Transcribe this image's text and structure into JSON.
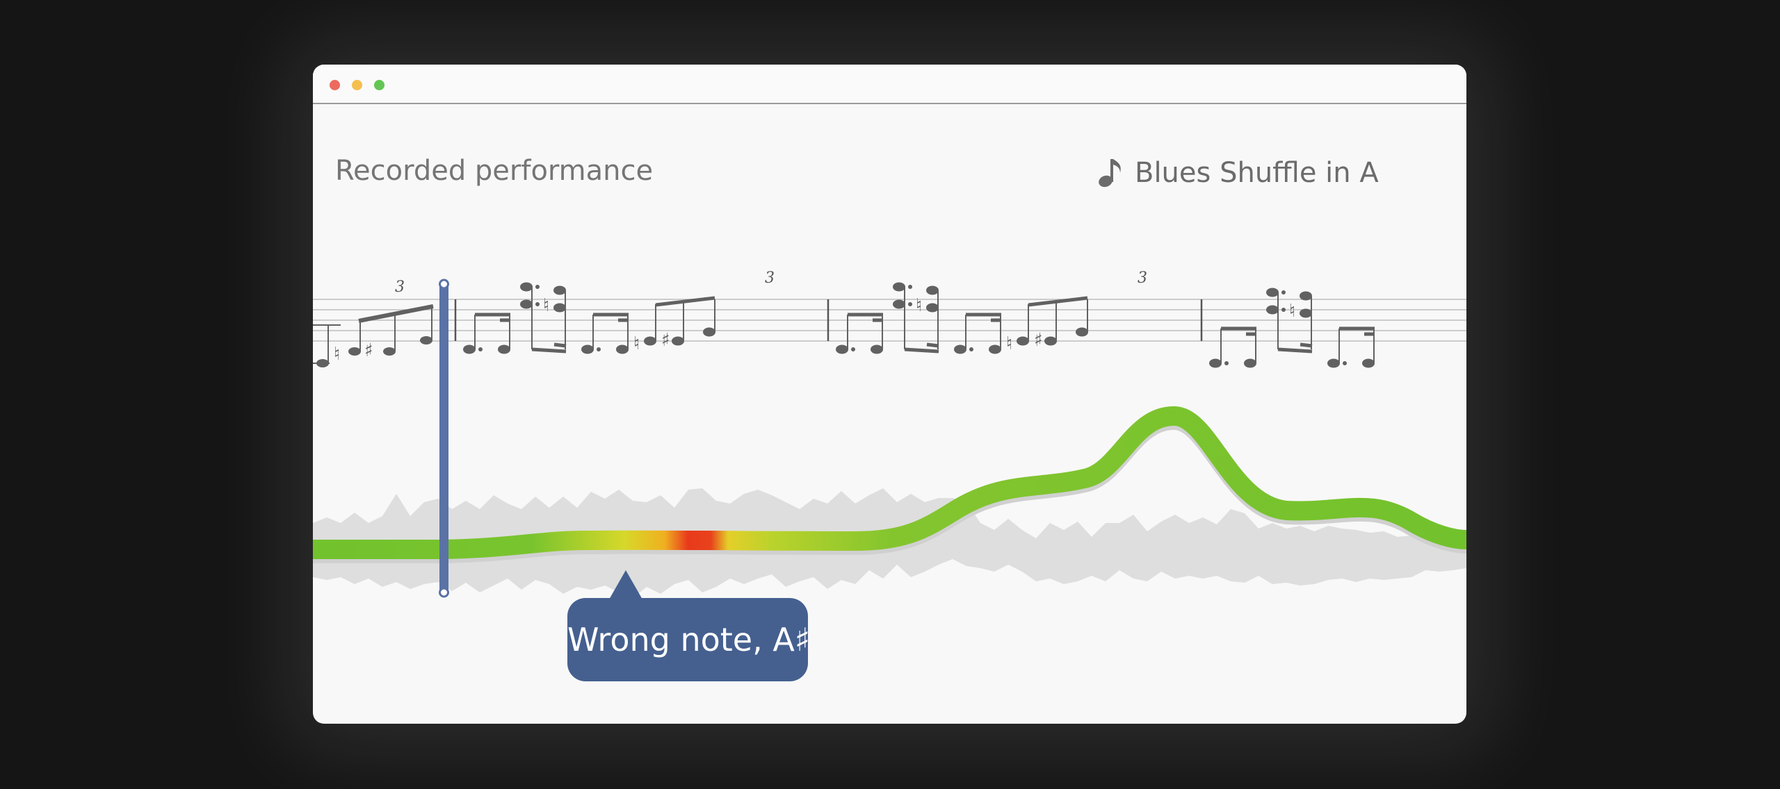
{
  "window": {
    "controls": [
      "close",
      "minimize",
      "maximize"
    ]
  },
  "header": {
    "performance_label": "Recorded performance",
    "song_icon": "music-note-icon",
    "song_title": "Blues Shuffle in A"
  },
  "score": {
    "triplet_marks": [
      "3",
      "3",
      "3"
    ]
  },
  "feedback": {
    "tooltip_text": "Wrong note, A♯"
  },
  "colors": {
    "accent": "#5a72a6",
    "pitch_correct": "#72c22d",
    "pitch_wrong": "#e83a1b",
    "waveform": "#dedede",
    "tooltip_bg": "#45608f"
  }
}
